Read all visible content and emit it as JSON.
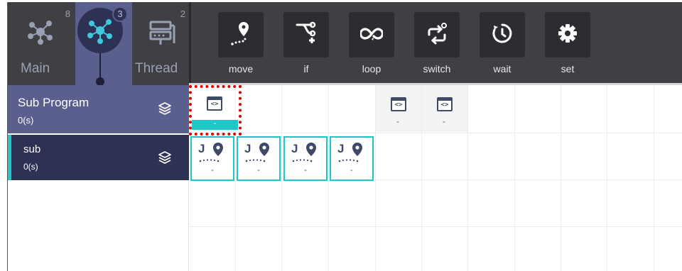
{
  "mode_tabs": [
    {
      "id": "main",
      "label": "Main",
      "count": "8",
      "active": false
    },
    {
      "id": "sub",
      "label": "",
      "count": "3",
      "active": true
    },
    {
      "id": "thread",
      "label": "Thread",
      "count": "2",
      "active": false
    }
  ],
  "toolbar": {
    "items": [
      {
        "label": "move",
        "icon": "map-pin-path-icon"
      },
      {
        "label": "if",
        "icon": "branch-icon"
      },
      {
        "label": "loop",
        "icon": "loop-icon"
      },
      {
        "label": "switch",
        "icon": "switch-icon"
      },
      {
        "label": "wait",
        "icon": "timer-icon"
      },
      {
        "label": "set",
        "icon": "gear-icon"
      }
    ]
  },
  "sidebar": {
    "header": {
      "title": "Sub Program",
      "time": "0(s)"
    },
    "items": [
      {
        "title": "sub",
        "time": "0(s)"
      }
    ]
  },
  "grid": {
    "row1": {
      "cells": [
        {
          "type": "script",
          "value": "-",
          "selected": true
        },
        {
          "type": "script",
          "value": "-"
        },
        {
          "type": "script",
          "value": "-"
        }
      ]
    },
    "row2": {
      "cells": [
        {
          "type": "move",
          "value": "-"
        },
        {
          "type": "move",
          "value": "-"
        },
        {
          "type": "move",
          "value": "-"
        },
        {
          "type": "move",
          "value": "-"
        }
      ]
    }
  },
  "colors": {
    "header_bg": "#3f3f44",
    "active_tab": "#5a5f8d",
    "dark_navy": "#2d3154",
    "accent_cyan": "#1ec8c8",
    "highlight_red": "#e00000"
  }
}
